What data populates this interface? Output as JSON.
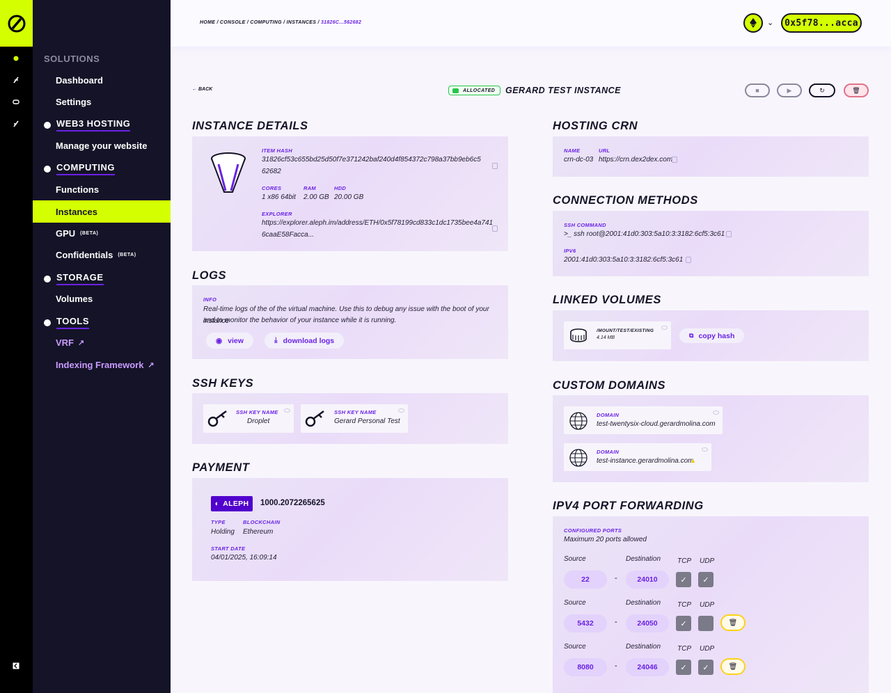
{
  "breadcrumb": {
    "path": "HOME / CONSOLE / COMPUTING / INSTANCES / ",
    "current": "31826C...562682"
  },
  "wallet": {
    "address": "0x5f78...acca"
  },
  "sidebar": {
    "section_solutions": "SOLUTIONS",
    "dashboard": "Dashboard",
    "settings": "Settings",
    "web3_hosting": "WEB3 HOSTING",
    "manage_website": "Manage your website",
    "computing": "COMPUTING",
    "functions": "Functions",
    "instances": "Instances",
    "gpu": "GPU",
    "confidentials": "Confidentials",
    "beta": "(BETA)",
    "storage": "STORAGE",
    "volumes": "Volumes",
    "tools": "TOOLS",
    "vrf": "VRF",
    "indexing": "Indexing Framework"
  },
  "header": {
    "back": "BACK",
    "status": "ALLOCATED",
    "title": "GERARD TEST INSTANCE"
  },
  "details": {
    "heading": "INSTANCE DETAILS",
    "item_hash_label": "ITEM HASH",
    "item_hash_1": "31826cf53c655bd25d50f7e371242baf240d4f854372c798a37bb9eb6c5",
    "item_hash_2": "62682",
    "cores_label": "CORES",
    "cores": "1 x86 64bit",
    "ram_label": "RAM",
    "ram": "2.00 GB",
    "hdd_label": "HDD",
    "hdd": "20.00 GB",
    "explorer_label": "EXPLORER",
    "explorer_1": "https://explorer.aleph.im/address/ETH/0x5f78199cd833c1dc1735bee4a741",
    "explorer_2": "6caaE58Facca..."
  },
  "logs": {
    "heading": "LOGS",
    "info_label": "INFO",
    "info_1": "Real-time logs of the of the virtual machine. Use this to debug any issue with the boot of your instance",
    "info_2": "and to monitor the behavior of your instance while it is running.",
    "view": "view",
    "download": "download logs"
  },
  "ssh": {
    "heading": "SSH KEYS",
    "keys": [
      {
        "label": "SSH KEY NAME",
        "name": "Droplet"
      },
      {
        "label": "SSH KEY NAME",
        "name": "Gerard Personal Test"
      }
    ]
  },
  "payment": {
    "heading": "PAYMENT",
    "token": "ALEPH",
    "amount": "1000.2072265625",
    "type_label": "TYPE",
    "type": "Holding",
    "chain_label": "BLOCKCHAIN",
    "chain": "Ethereum",
    "start_label": "START DATE",
    "start": "04/01/2025, 16:09:14"
  },
  "crn": {
    "heading": "HOSTING CRN",
    "name_label": "NAME",
    "name": "crn-dc-03",
    "url_label": "URL",
    "url": "https://crn.dex2dex.com"
  },
  "connection": {
    "heading": "CONNECTION METHODS",
    "ssh_label": "SSH COMMAND",
    "ssh": ">_  ssh root@2001:41d0:303:5a10:3:3182:6cf5:3c61",
    "ipv6_label": "IPV6",
    "ipv6": "2001:41d0:303:5a10:3:3182:6cf5:3c61"
  },
  "volumes": {
    "heading": "LINKED VOLUMES",
    "path": "/MOUNT/TEST/EXISTING",
    "size": "4.14 MB",
    "copy": "copy hash"
  },
  "domains": {
    "heading": "CUSTOM DOMAINS",
    "items": [
      {
        "label": "DOMAIN",
        "value": "test-twentysix-cloud.gerardmolina.com"
      },
      {
        "label": "DOMAIN",
        "value": "test-instance.gerardmolina.com"
      }
    ]
  },
  "ports": {
    "heading": "IPV4 PORT FORWARDING",
    "configured_label": "CONFIGURED PORTS",
    "max": "Maximum 20 ports allowed",
    "source": "Source",
    "destination": "Destination",
    "tcp": "TCP",
    "udp": "UDP",
    "rows": [
      {
        "source": "22",
        "destination": "24010",
        "tcp": true,
        "udp": true
      },
      {
        "source": "5432",
        "destination": "24050",
        "tcp": true,
        "udp": false
      },
      {
        "source": "8080",
        "destination": "24046",
        "tcp": true,
        "udp": true
      }
    ]
  },
  "colors": {
    "accent": "#d4ff00",
    "primary": "#6a22e5",
    "dark": "#141327"
  }
}
